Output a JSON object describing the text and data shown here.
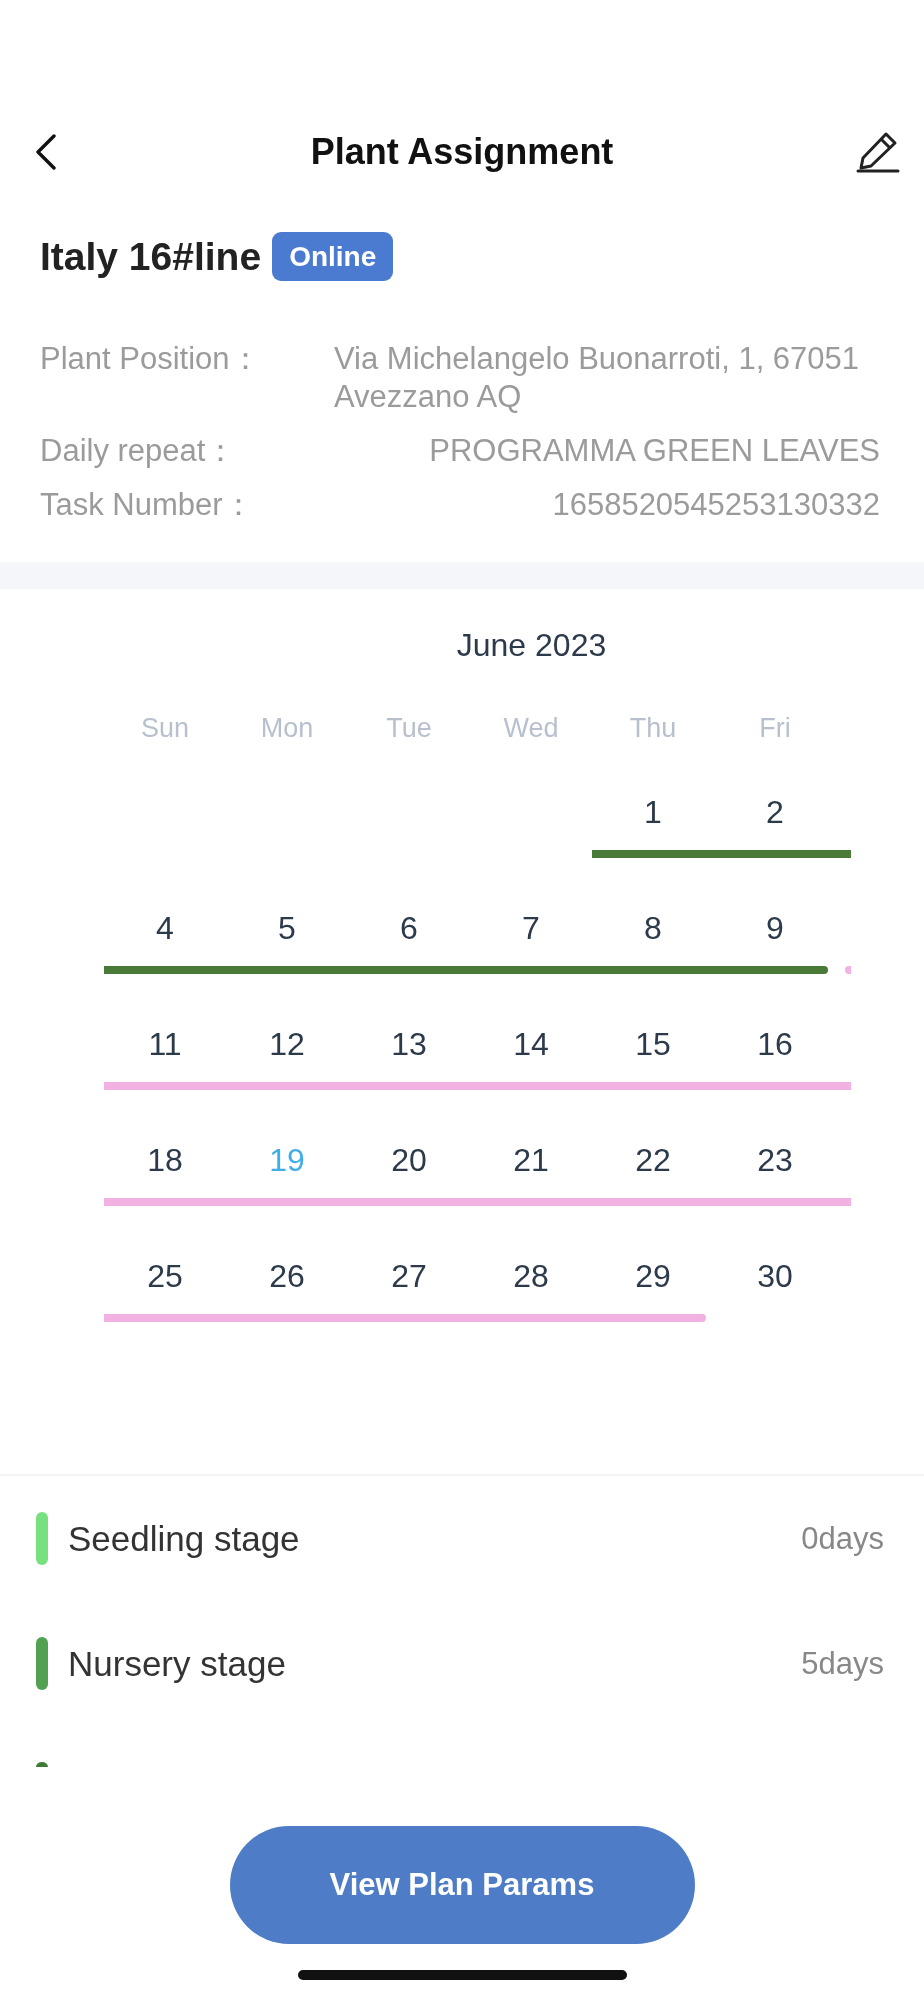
{
  "header": {
    "title": "Plant Assignment"
  },
  "line": {
    "name": "Italy 16#line",
    "status": "Online"
  },
  "info": [
    {
      "label": "Plant Position：",
      "value": "Via Michelangelo Buonarroti, 1, 67051 Avezzano AQ"
    },
    {
      "label": "Daily repeat：",
      "value": "PROGRAMMA GREEN LEAVES"
    },
    {
      "label": "Task Number：",
      "value": "1658520545253130332"
    }
  ],
  "calendar": {
    "title": "June 2023",
    "weekdays": [
      "Sun",
      "Mon",
      "Tue",
      "Wed",
      "Thu",
      "Fri"
    ],
    "weeks": [
      {
        "runs": [
          {
            "days": [
              {
                "kind": "blank"
              },
              {
                "kind": "blank"
              },
              {
                "kind": "blank"
              },
              {
                "kind": "blank"
              }
            ]
          },
          {
            "color": "#4a7a37",
            "days": [
              {
                "kind": "date",
                "day": "1",
                "today": false
              },
              {
                "kind": "date",
                "day": "2",
                "today": false
              },
              {
                "kind": "blank"
              }
            ]
          }
        ]
      },
      {
        "runs": [
          {
            "color": "#4a7a37",
            "days": [
              {
                "kind": "date",
                "day": "4",
                "today": false
              },
              {
                "kind": "date",
                "day": "5",
                "today": false
              },
              {
                "kind": "date",
                "day": "6",
                "today": false
              },
              {
                "kind": "date",
                "day": "7",
                "today": false
              },
              {
                "kind": "date",
                "day": "8",
                "today": false
              },
              {
                "kind": "date",
                "day": "9",
                "today": false
              }
            ]
          },
          {
            "color": "#f2b1e3",
            "days": [
              {
                "kind": "blank"
              }
            ]
          }
        ]
      },
      {
        "runs": [
          {
            "color": "#f2b1e3",
            "days": [
              {
                "kind": "date",
                "day": "11",
                "today": false
              },
              {
                "kind": "date",
                "day": "12",
                "today": false
              },
              {
                "kind": "date",
                "day": "13",
                "today": false
              },
              {
                "kind": "date",
                "day": "14",
                "today": false
              },
              {
                "kind": "date",
                "day": "15",
                "today": false
              },
              {
                "kind": "date",
                "day": "16",
                "today": false
              },
              {
                "kind": "blank"
              }
            ]
          }
        ]
      },
      {
        "runs": [
          {
            "color": "#f2b1e3",
            "days": [
              {
                "kind": "date",
                "day": "18",
                "today": false
              },
              {
                "kind": "date",
                "day": "19",
                "today": true
              },
              {
                "kind": "date",
                "day": "20",
                "today": false
              },
              {
                "kind": "date",
                "day": "21",
                "today": false
              },
              {
                "kind": "date",
                "day": "22",
                "today": false
              },
              {
                "kind": "date",
                "day": "23",
                "today": false
              },
              {
                "kind": "blank"
              }
            ]
          }
        ]
      },
      {
        "runs": [
          {
            "color": "#f2b1e3",
            "days": [
              {
                "kind": "date",
                "day": "25",
                "today": false
              },
              {
                "kind": "date",
                "day": "26",
                "today": false
              },
              {
                "kind": "date",
                "day": "27",
                "today": false
              },
              {
                "kind": "date",
                "day": "28",
                "today": false
              },
              {
                "kind": "date",
                "day": "29",
                "today": false
              }
            ]
          },
          {
            "days": [
              {
                "kind": "date",
                "day": "30",
                "today": false
              }
            ]
          }
        ]
      }
    ]
  },
  "stages": [
    {
      "name": "Seedling stage",
      "duration": "0days",
      "color": "#77e07f"
    },
    {
      "name": "Nursery stage",
      "duration": "5days",
      "color": "#52a152"
    },
    {
      "color": "#3f7b36"
    }
  ],
  "actions": {
    "primary": "View Plan Params"
  }
}
